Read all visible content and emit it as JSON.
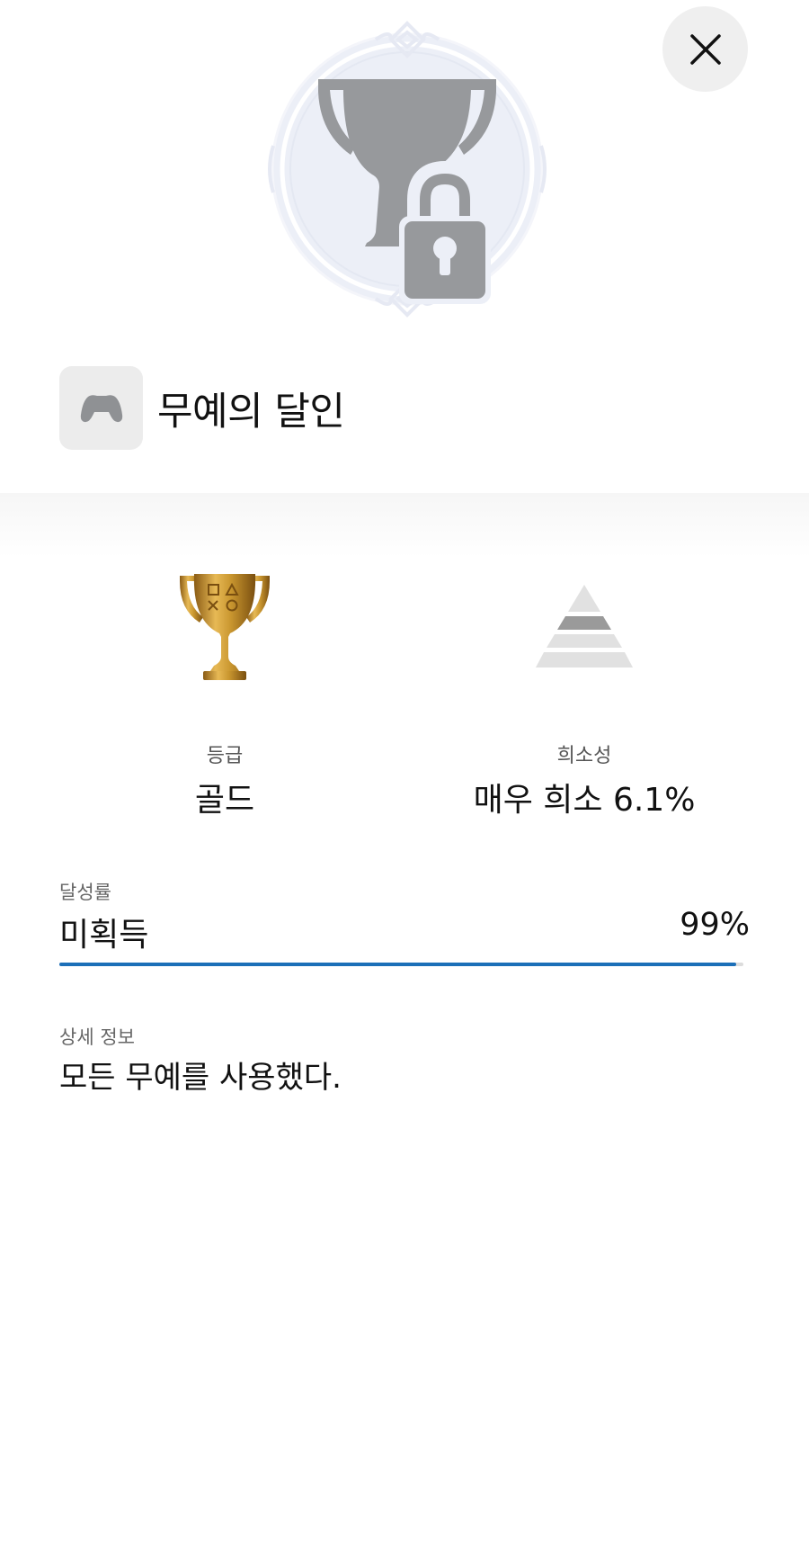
{
  "header": {
    "close_icon": "close-icon",
    "hero_icon": "locked-trophy-icon"
  },
  "trophy": {
    "title": "무예의 달인",
    "game_icon": "controller-icon"
  },
  "stats": {
    "grade": {
      "label": "등급",
      "value": "골드",
      "icon": "gold-trophy-icon"
    },
    "rarity": {
      "label": "희소성",
      "value": "매우 희소 6.1%",
      "icon": "rarity-pyramid-icon"
    }
  },
  "progress": {
    "label": "달성률",
    "status": "미획득",
    "percent_text": "99%",
    "percent": 99
  },
  "details": {
    "label": "상세 정보",
    "text": "모든 무예를 사용했다."
  },
  "colors": {
    "accent": "#1c6fb8",
    "gold": "#c9962f",
    "locked_gray": "#97999c",
    "emblem_bg": "#eceff7"
  }
}
